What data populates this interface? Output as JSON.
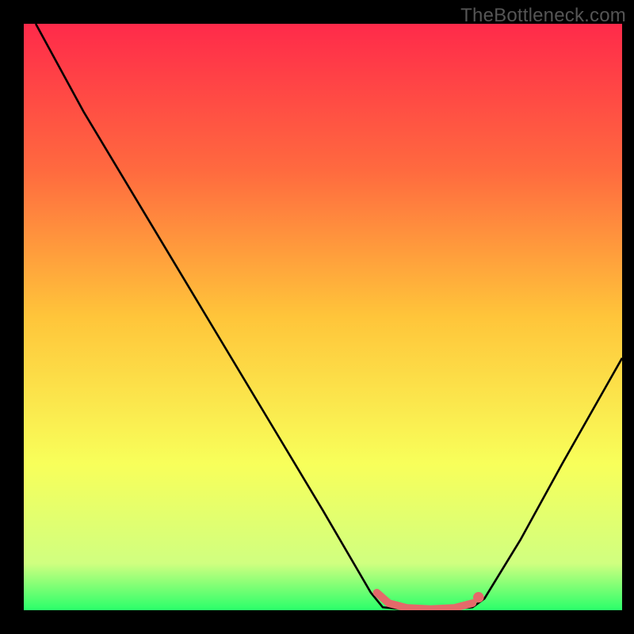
{
  "watermark": "TheBottleneck.com",
  "chart_data": {
    "type": "line",
    "title": "",
    "xlabel": "",
    "ylabel": "",
    "xlim": [
      0,
      100
    ],
    "ylim": [
      0,
      100
    ],
    "background_gradient": {
      "stops": [
        {
          "offset": 0,
          "color": "#ff2a4a"
        },
        {
          "offset": 0.25,
          "color": "#ff6a3f"
        },
        {
          "offset": 0.5,
          "color": "#ffc53a"
        },
        {
          "offset": 0.75,
          "color": "#f8ff5a"
        },
        {
          "offset": 0.92,
          "color": "#d0ff80"
        },
        {
          "offset": 1.0,
          "color": "#2aff6a"
        }
      ]
    },
    "series": [
      {
        "name": "bottleneck-curve",
        "color": "#000000",
        "points": [
          {
            "x": 2,
            "y": 100
          },
          {
            "x": 10,
            "y": 85
          },
          {
            "x": 20,
            "y": 68
          },
          {
            "x": 30,
            "y": 51
          },
          {
            "x": 40,
            "y": 34
          },
          {
            "x": 50,
            "y": 17
          },
          {
            "x": 58,
            "y": 3
          },
          {
            "x": 60,
            "y": 0.5
          },
          {
            "x": 65,
            "y": 0
          },
          {
            "x": 70,
            "y": 0
          },
          {
            "x": 75,
            "y": 0.5
          },
          {
            "x": 77,
            "y": 2
          },
          {
            "x": 83,
            "y": 12
          },
          {
            "x": 90,
            "y": 25
          },
          {
            "x": 100,
            "y": 43
          }
        ]
      },
      {
        "name": "optimal-highlight",
        "color": "#e46a6a",
        "stroke_width": 8,
        "points": [
          {
            "x": 59,
            "y": 3
          },
          {
            "x": 61,
            "y": 1.2
          },
          {
            "x": 64,
            "y": 0.4
          },
          {
            "x": 68,
            "y": 0.2
          },
          {
            "x": 72,
            "y": 0.4
          },
          {
            "x": 75,
            "y": 1.2
          }
        ],
        "end_marker": {
          "x": 76,
          "y": 2.2,
          "r": 6
        }
      }
    ]
  }
}
